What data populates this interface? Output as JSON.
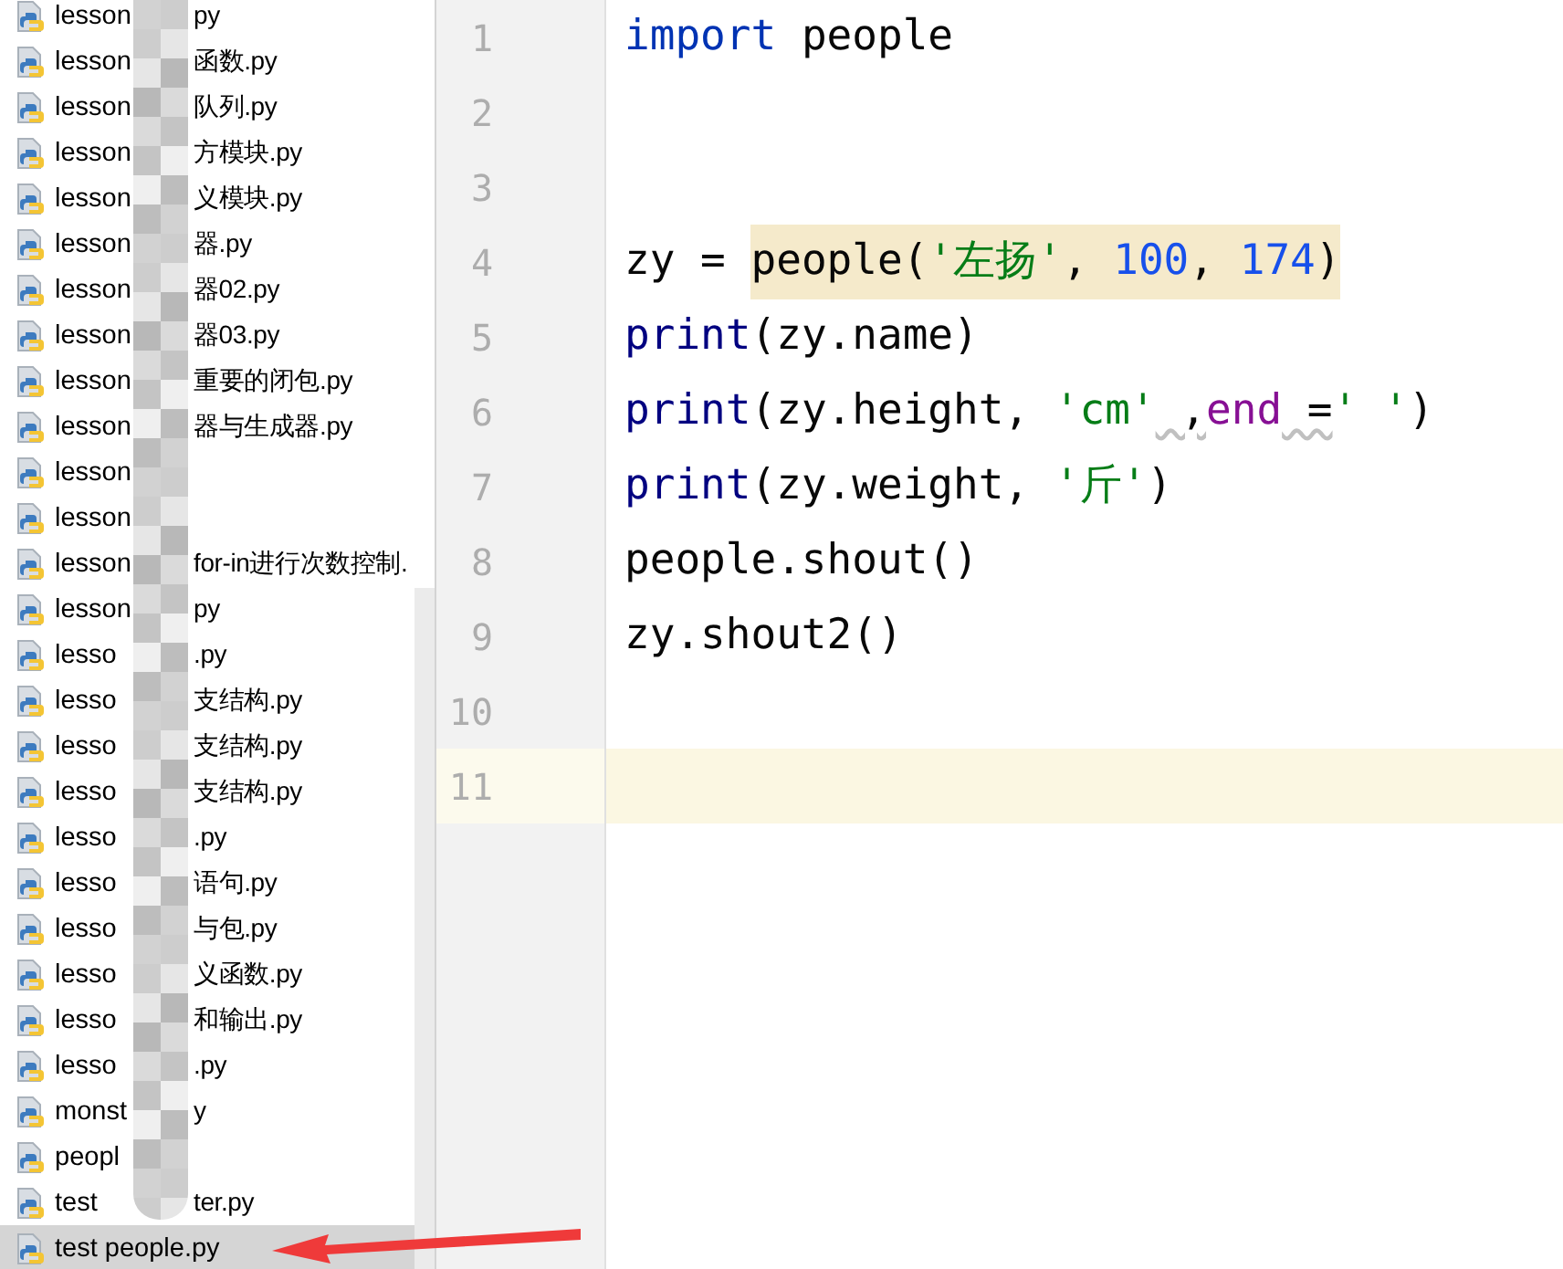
{
  "project_files": [
    {
      "prefix": "lesson",
      "suffix": "py",
      "selected": false
    },
    {
      "prefix": "lesson",
      "suffix": "函数.py",
      "selected": false
    },
    {
      "prefix": "lesson",
      "suffix": "队列.py",
      "selected": false
    },
    {
      "prefix": "lesson",
      "suffix": "方模块.py",
      "selected": false
    },
    {
      "prefix": "lesson",
      "suffix": "义模块.py",
      "selected": false
    },
    {
      "prefix": "lesson",
      "suffix": "器.py",
      "selected": false
    },
    {
      "prefix": "lesson",
      "suffix": "器02.py",
      "selected": false
    },
    {
      "prefix": "lesson",
      "suffix": "器03.py",
      "selected": false
    },
    {
      "prefix": "lesson",
      "suffix": "重要的闭包.py",
      "selected": false
    },
    {
      "prefix": "lesson",
      "suffix": "器与生成器.py",
      "selected": false
    },
    {
      "prefix": "lesson",
      "selected": false
    },
    {
      "prefix": "lesson",
      "selected": false
    },
    {
      "prefix": "lesson",
      "suffix": "for-in进行次数控制.",
      "selected": false
    },
    {
      "prefix": "lesson",
      "suffix": "py",
      "selected": false
    },
    {
      "prefix": "lesso",
      "suffix": ".py",
      "selected": false
    },
    {
      "prefix": "lesso",
      "suffix": "支结构.py",
      "selected": false
    },
    {
      "prefix": "lesso",
      "suffix": "支结构.py",
      "selected": false
    },
    {
      "prefix": "lesso",
      "suffix": "支结构.py",
      "selected": false
    },
    {
      "prefix": "lesso",
      "suffix": ".py",
      "selected": false
    },
    {
      "prefix": "lesso",
      "suffix": "语句.py",
      "selected": false
    },
    {
      "prefix": "lesso",
      "suffix": "与包.py",
      "selected": false
    },
    {
      "prefix": "lesso",
      "suffix": "义函数.py",
      "selected": false
    },
    {
      "prefix": "lesso",
      "suffix": "和输出.py",
      "selected": false
    },
    {
      "prefix": "lesso",
      "suffix": ".py",
      "selected": false
    },
    {
      "prefix": "monst",
      "suffix": "y",
      "selected": false
    },
    {
      "prefix": "peopl",
      "selected": false
    },
    {
      "prefix": "test",
      "suffix": "ter.py",
      "selected": false
    },
    {
      "prefix": "test people.py",
      "selected": true
    }
  ],
  "editor": {
    "lines": [
      {
        "number": "1",
        "current": false,
        "tokens": [
          {
            "text": "import",
            "kind": "keyword"
          },
          {
            "text": " people",
            "kind": "plain"
          }
        ]
      },
      {
        "number": "2",
        "current": false
      },
      {
        "number": "3",
        "current": false
      },
      {
        "number": "4",
        "current": false,
        "tokens": [
          {
            "text": "zy = ",
            "kind": "plain"
          },
          {
            "text": "people(",
            "kind": "plain",
            "highlighted": true
          },
          {
            "text": "'左扬'",
            "kind": "string",
            "highlighted": true
          },
          {
            "text": ", ",
            "kind": "plain",
            "highlighted": true
          },
          {
            "text": "100",
            "kind": "number",
            "highlighted": true
          },
          {
            "text": ", ",
            "kind": "plain",
            "highlighted": true
          },
          {
            "text": "174",
            "kind": "number",
            "highlighted": true
          },
          {
            "text": ")",
            "kind": "plain",
            "highlighted": true
          }
        ]
      },
      {
        "number": "5",
        "current": false,
        "tokens": [
          {
            "text": "print",
            "kind": "builtin"
          },
          {
            "text": "(zy.name)",
            "kind": "plain"
          }
        ]
      },
      {
        "number": "6",
        "current": false,
        "tokens": [
          {
            "text": "print",
            "kind": "builtin"
          },
          {
            "text": "(zy.height, ",
            "kind": "plain"
          },
          {
            "text": "'cm'",
            "kind": "string"
          },
          {
            "text": " ,",
            "kind": "plain",
            "warning": true
          },
          {
            "text": "end",
            "kind": "param"
          },
          {
            "text": " =",
            "kind": "plain",
            "warning": true
          },
          {
            "text": "' '",
            "kind": "string"
          },
          {
            "text": ")",
            "kind": "plain"
          }
        ]
      },
      {
        "number": "7",
        "current": false,
        "tokens": [
          {
            "text": "print",
            "kind": "builtin"
          },
          {
            "text": "(zy.weight, ",
            "kind": "plain"
          },
          {
            "text": "'斤'",
            "kind": "string"
          },
          {
            "text": ")",
            "kind": "plain"
          }
        ]
      },
      {
        "number": "8",
        "current": false,
        "tokens": [
          {
            "text": "people.shout()",
            "kind": "plain"
          }
        ]
      },
      {
        "number": "9",
        "current": false,
        "tokens": [
          {
            "text": "zy.shout2()",
            "kind": "plain"
          }
        ]
      },
      {
        "number": "10",
        "current": false
      },
      {
        "number": "11",
        "current": true
      }
    ]
  }
}
